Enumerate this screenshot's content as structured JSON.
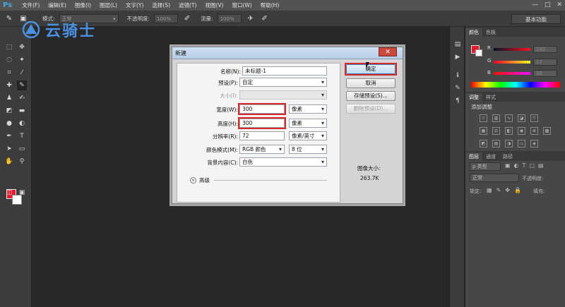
{
  "menubar": {
    "logo": "Ps",
    "items": [
      "文件(F)",
      "编辑(E)",
      "图像(I)",
      "图层(L)",
      "文字(Y)",
      "选择(S)",
      "滤镜(T)",
      "视图(V)",
      "窗口(W)",
      "帮助(H)"
    ],
    "window_controls": [
      "—",
      "□",
      "✕"
    ]
  },
  "options_bar": {
    "mode_label": "模式:",
    "mode_value": "正常",
    "opacity_label": "不透明度:",
    "opacity_value": "100%",
    "flow_label": "流量:",
    "flow_value": "100%",
    "workspace": "基本功能"
  },
  "watermark": {
    "text": "云骑士"
  },
  "color_panel": {
    "tabs": [
      "颜色",
      "色板"
    ],
    "r": "242",
    "g": "17",
    "b": "36",
    "label_r": "R",
    "label_g": "G",
    "label_b": "B"
  },
  "adjust_panel": {
    "tabs": [
      "调整",
      "样式"
    ],
    "title": "添加调整"
  },
  "layers_panel": {
    "tabs": [
      "图层",
      "通道",
      "路径"
    ],
    "kind": "ρ 类型",
    "blend": "正常",
    "opacity_label": "不透明度:",
    "lock_label": "锁定:",
    "fill_label": "填充:"
  },
  "dialog": {
    "title": "新建",
    "close": "✕",
    "name_label": "名称(N):",
    "name_value": "未标题-1",
    "preset_label": "预设(P):",
    "preset_value": "自定",
    "size_label": "大小(I):",
    "width_label": "宽度(W):",
    "width_value": "300",
    "width_unit": "像素",
    "height_label": "高度(H):",
    "height_value": "300",
    "height_unit": "像素",
    "resolution_label": "分辨率(R):",
    "resolution_value": "72",
    "resolution_unit": "像素/英寸",
    "color_mode_label": "颜色模式(M):",
    "color_mode_value": "RGB 颜色",
    "bit_depth": "8 位",
    "bg_label": "背景内容(C):",
    "bg_value": "白色",
    "advanced_label": "高级",
    "ok": "确定",
    "cancel": "取消",
    "save_preset": "存储预设(S)...",
    "delete_preset": "删除预设(D)...",
    "image_size_label": "图像大小:",
    "image_size_value": "263.7K"
  },
  "colors": {
    "foreground": "#e8192c",
    "background": "#ffffff",
    "highlight": "#d62a2a",
    "accent": "#4a90e2"
  }
}
